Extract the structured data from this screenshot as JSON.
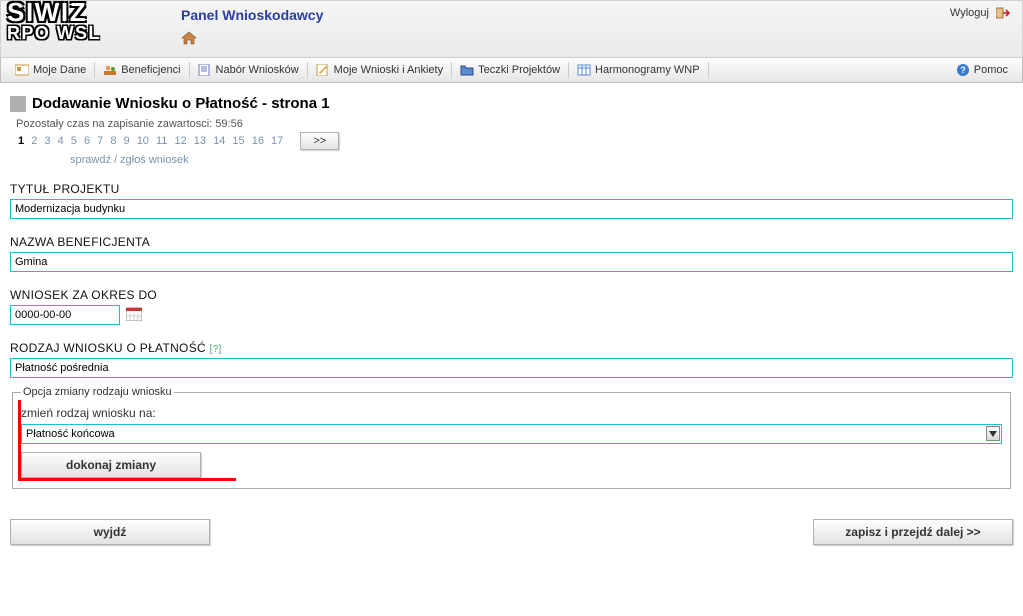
{
  "header": {
    "title": "Panel Wnioskodawcy",
    "logout": "Wyloguj"
  },
  "logo": {
    "line1": "SIWIZ",
    "line2": "RPO WSL"
  },
  "menu": {
    "items": [
      "Moje Dane",
      "Beneficjenci",
      "Nabór Wniosków",
      "Moje Wnioski i Ankiety",
      "Teczki Projektów",
      "Harmonogramy WNP"
    ],
    "help": "Pomoc"
  },
  "page": {
    "title": "Dodawanie Wniosku o Płatność - strona 1",
    "remaining_label": "Pozostały czas na zapisanie zawartosci: 59:56",
    "pager_next": ">>",
    "pager_sub": "sprawdź / zgłoś wniosek"
  },
  "fields": {
    "project_title_label": "TYTUŁ PROJEKTU",
    "project_title_value": "Modernizacja budynku",
    "beneficiary_label": "NAZWA BENEFICJENTA",
    "beneficiary_value": "Gmina",
    "period_label": "WNIOSEK ZA OKRES DO",
    "period_value": "0000-00-00",
    "type_label": "RODZAJ WNIOSKU O PŁATNOŚĆ",
    "type_hint": "[?]",
    "type_value": "Płatność pośrednia",
    "change_legend": "Opcja zmiany rodzaju wniosku",
    "change_sublabel": "zmień rodzaj wniosku na:",
    "change_select_value": "Płatność końcowa",
    "change_button": "dokonaj zmiany"
  },
  "footer": {
    "exit": "wyjdź",
    "save_next": "zapisz i przejdź dalej >>"
  }
}
